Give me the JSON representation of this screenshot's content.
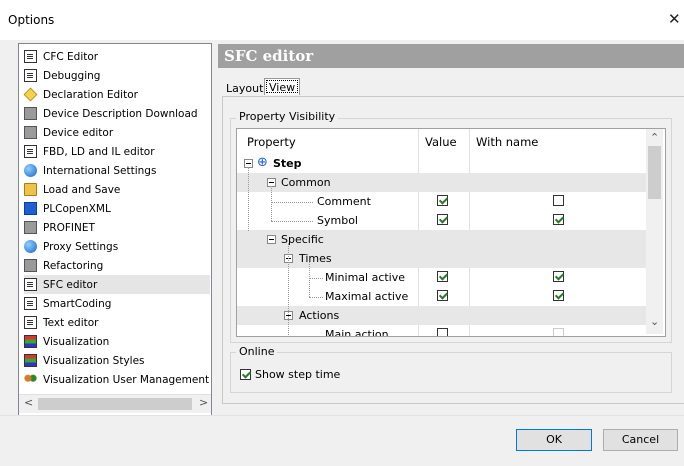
{
  "window": {
    "title": "Options",
    "close_glyph": "✕"
  },
  "tree": {
    "items": [
      {
        "label": "CFC Editor",
        "icon": "cfc-editor-icon"
      },
      {
        "label": "Debugging",
        "icon": "debugging-icon"
      },
      {
        "label": "Declaration Editor",
        "icon": "declaration-editor-icon"
      },
      {
        "label": "Device Description Download",
        "icon": "device-description-icon"
      },
      {
        "label": "Device editor",
        "icon": "device-editor-icon"
      },
      {
        "label": "FBD, LD and IL editor",
        "icon": "fbd-editor-icon"
      },
      {
        "label": "International Settings",
        "icon": "globe-icon"
      },
      {
        "label": "Load and Save",
        "icon": "folder-icon"
      },
      {
        "label": "PLCopenXML",
        "icon": "plcopenxml-icon"
      },
      {
        "label": "PROFINET",
        "icon": "profinet-icon"
      },
      {
        "label": "Proxy Settings",
        "icon": "proxy-icon"
      },
      {
        "label": "Refactoring",
        "icon": "refactoring-icon"
      },
      {
        "label": "SFC editor",
        "icon": "sfc-editor-icon",
        "selected": true
      },
      {
        "label": "SmartCoding",
        "icon": "smartcoding-icon"
      },
      {
        "label": "Text editor",
        "icon": "text-editor-icon"
      },
      {
        "label": "Visualization",
        "icon": "visualization-icon"
      },
      {
        "label": "Visualization Styles",
        "icon": "visualization-styles-icon"
      },
      {
        "label": "Visualization User Management",
        "icon": "users-icon"
      }
    ]
  },
  "panel": {
    "header": "SFC editor",
    "tabs": [
      {
        "label": "Layout"
      },
      {
        "label": "View",
        "selected": true
      }
    ],
    "property_visibility": {
      "title": "Property Visibility",
      "columns": [
        "Property",
        "Value",
        "With name"
      ],
      "rows": [
        {
          "label": "Step",
          "value": null,
          "with_name": null
        },
        {
          "label": "Common",
          "value": null,
          "with_name": null
        },
        {
          "label": "Comment",
          "value": true,
          "with_name": false
        },
        {
          "label": "Symbol",
          "value": true,
          "with_name": true
        },
        {
          "label": "Specific",
          "value": null,
          "with_name": null
        },
        {
          "label": "Times",
          "value": null,
          "with_name": null
        },
        {
          "label": "Minimal active",
          "value": true,
          "with_name": true
        },
        {
          "label": "Maximal active",
          "value": true,
          "with_name": true
        },
        {
          "label": "Actions",
          "value": null,
          "with_name": null
        },
        {
          "label": "Main action",
          "value": false,
          "with_name": false
        }
      ]
    },
    "online": {
      "title": "Online",
      "show_step_time_label": "Show step time",
      "show_step_time_checked": true
    }
  },
  "buttons": {
    "ok": "OK",
    "cancel": "Cancel"
  },
  "colors": {
    "header_bg": "#a0a0a0",
    "accent": "#0078d7",
    "check": "#2a7a2a"
  }
}
